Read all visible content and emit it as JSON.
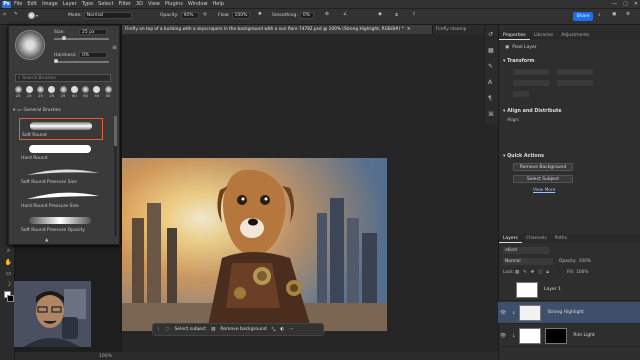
{
  "menubar": {
    "logo": "Ps",
    "items": [
      "File",
      "Edit",
      "Image",
      "Layer",
      "Type",
      "Select",
      "Filter",
      "3D",
      "View",
      "Plugins",
      "Window",
      "Help"
    ],
    "window_controls": [
      "—",
      "▢",
      "✕"
    ]
  },
  "options": {
    "mode_label": "Mode:",
    "mode_value": "Normal",
    "opacity_label": "Opacity:",
    "opacity_value": "90%",
    "flow_label": "Flow:",
    "flow_value": "100%",
    "smoothing_label": "Smoothing:",
    "smoothing_value": "0%",
    "share_label": "Share"
  },
  "brush_panel": {
    "size_label": "Size:",
    "size_value": "25 px",
    "hardness_label": "Hardness:",
    "hardness_value": "0%",
    "search_placeholder": "Search Brushes",
    "preset_sizes": [
      "25",
      "25",
      "25",
      "25",
      "25",
      "50",
      "50",
      "50",
      "50"
    ],
    "group_label": "General Brushes",
    "brushes": [
      "Soft Round",
      "Hard Round",
      "Soft Round Pressure Size",
      "Hard Round Pressure Size",
      "Soft Round Pressure Opacity"
    ],
    "selected_brush": "Soft Round"
  },
  "doc_tabs": {
    "active": "Firefly on top of a building with a skyscrapers in the background with a sun flare 74782.psd @ 100% (Strong Highlight, RGB/8#) *",
    "inactive": "Firefly steamp"
  },
  "context_bar": {
    "select_subject": "Select subject",
    "remove_background": "Remove background",
    "more": "···"
  },
  "status": {
    "zoom": "100%"
  },
  "properties": {
    "tabs": [
      "Properties",
      "Libraries",
      "Adjustments"
    ],
    "layer_type": "Pixel Layer",
    "transform_title": "Transform",
    "align_title": "Align and Distribute",
    "align_label": "Align:",
    "quick_actions_title": "Quick Actions",
    "remove_bg_btn": "Remove Background",
    "select_subject_btn": "Select Subject",
    "view_more": "View More"
  },
  "layers": {
    "tabs": [
      "Layers",
      "Channels",
      "Paths"
    ],
    "kind_label": "Kind",
    "blend_mode": "Normal",
    "opacity_label": "Opacity:",
    "opacity_value": "100%",
    "lock_label": "Lock:",
    "fill_label": "Fill:",
    "fill_value": "100%",
    "rows": [
      {
        "name": "Layer 1"
      },
      {
        "name": "Strong Highlight"
      },
      {
        "name": "Rim Light"
      }
    ]
  },
  "colors": {
    "accent": "#1f6fe6",
    "panel": "#2e2e2e",
    "selected_brush_border": "#e0603a",
    "selected_layer": "#3d4f6b"
  }
}
